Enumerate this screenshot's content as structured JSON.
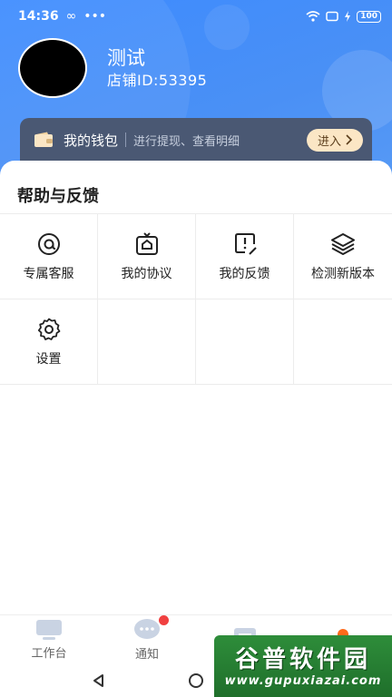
{
  "status_bar": {
    "time": "14:36",
    "battery": "100"
  },
  "profile": {
    "name": "测试",
    "store_id": "店铺ID:53395"
  },
  "wallet": {
    "title": "我的钱包",
    "subtitle": "进行提现、查看明细",
    "button": "进入"
  },
  "section": {
    "title": "帮助与反馈"
  },
  "grid": {
    "items": [
      {
        "label": "专属客服",
        "icon": "at-icon"
      },
      {
        "label": "我的协议",
        "icon": "agreement-icon"
      },
      {
        "label": "我的反馈",
        "icon": "feedback-icon"
      },
      {
        "label": "检测新版本",
        "icon": "layers-icon"
      },
      {
        "label": "设置",
        "icon": "gear-icon"
      }
    ]
  },
  "tabbar": {
    "tabs": [
      {
        "label": "工作台",
        "icon": "workbench-icon"
      },
      {
        "label": "通知",
        "icon": "chat-icon"
      },
      {
        "label": "",
        "icon": "list-icon"
      },
      {
        "label": "",
        "icon": "person-icon"
      }
    ]
  },
  "watermark": {
    "line1": "谷普软件园",
    "line2": "www.gupuxiazai.com"
  },
  "colors": {
    "header": "#4a90f5",
    "accent": "#ff6a1a",
    "wallet_bg": "#4a5873",
    "badge": "#f04040"
  }
}
